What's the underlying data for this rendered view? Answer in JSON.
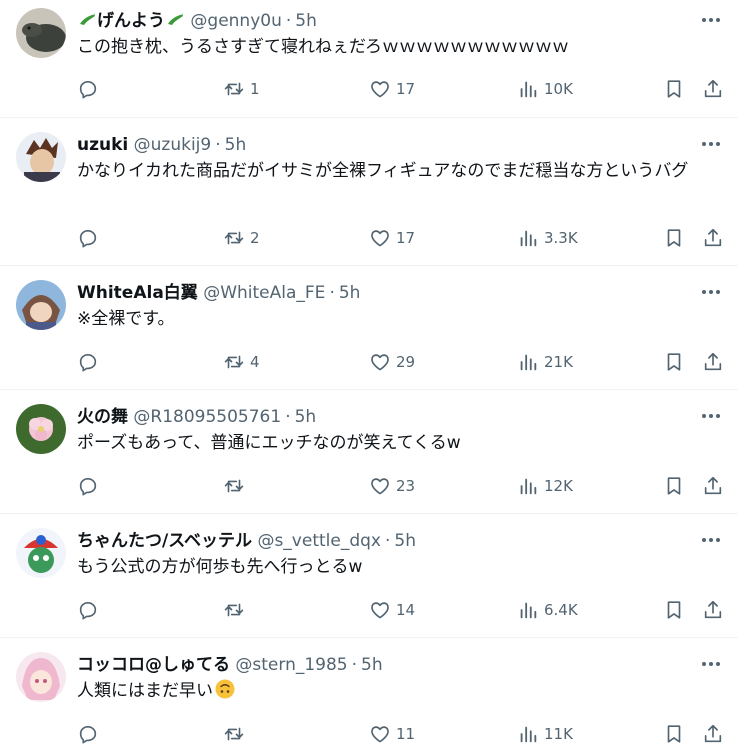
{
  "tweets": [
    {
      "name": "げんよう",
      "handle": "@genny0u",
      "separator": "·",
      "time": "5h",
      "text": "この抱き枕、うるさすぎて寝れねぇだろｗｗｗｗｗｗｗｗｗｗｗ",
      "replies": "",
      "retweets": "1",
      "likes": "17",
      "views": "10K",
      "avatar": {
        "bg": "#c7c2b8",
        "fg": "#3b3f3a"
      }
    },
    {
      "name": "uzuki",
      "handle": "@uzukij9",
      "separator": "·",
      "time": "5h",
      "text": "かなりイカれた商品だがイサミが全裸フィギュアなのでまだ穏当な方というバグ",
      "replies": "",
      "retweets": "2",
      "likes": "17",
      "views": "3.3K",
      "avatar": {
        "bg": "#e8eef5",
        "fg": "#5a3a2a"
      }
    },
    {
      "name": "WhiteAla白翼",
      "handle": "@WhiteAla_FE",
      "separator": "·",
      "time": "5h",
      "text": "※全裸です。",
      "replies": "",
      "retweets": "4",
      "likes": "29",
      "views": "21K",
      "avatar": {
        "bg": "#8fb3d9",
        "fg": "#6a4a3a"
      }
    },
    {
      "name": "火の舞",
      "handle": "@R18095505761",
      "separator": "·",
      "time": "5h",
      "text": "ポーズもあって、普通にエッチなのが笑えてくるw",
      "replies": "",
      "retweets": "",
      "likes": "23",
      "views": "12K",
      "avatar": {
        "bg": "#3f6b2f",
        "fg": "#f4c8d6"
      }
    },
    {
      "name": "ちゃんたつ/スベッテル",
      "handle": "@s_vettle_dqx",
      "separator": "·",
      "time": "5h",
      "text": "もう公式の方が何歩も先へ行っとるw",
      "replies": "",
      "retweets": "",
      "likes": "14",
      "views": "6.4K",
      "avatar": {
        "bg": "#f1f4fb",
        "fg": "#d8352f"
      }
    },
    {
      "name": "コッコロ@しゅてる",
      "handle": "@stern_1985",
      "separator": "·",
      "time": "5h",
      "text": "人類にはまだ早い",
      "replies": "",
      "retweets": "",
      "likes": "11",
      "views": "11K",
      "avatar": {
        "bg": "#f6e6ee",
        "fg": "#e8a6c4"
      }
    }
  ],
  "icons": {
    "reply": "reply-icon",
    "retweet": "retweet-icon",
    "like": "heart-icon",
    "views": "views-icon",
    "bookmark": "bookmark-icon",
    "share": "share-icon",
    "more": "more-icon"
  },
  "colors": {
    "text": "#0f1419",
    "muted": "#536471",
    "divider": "#eff3f4"
  }
}
